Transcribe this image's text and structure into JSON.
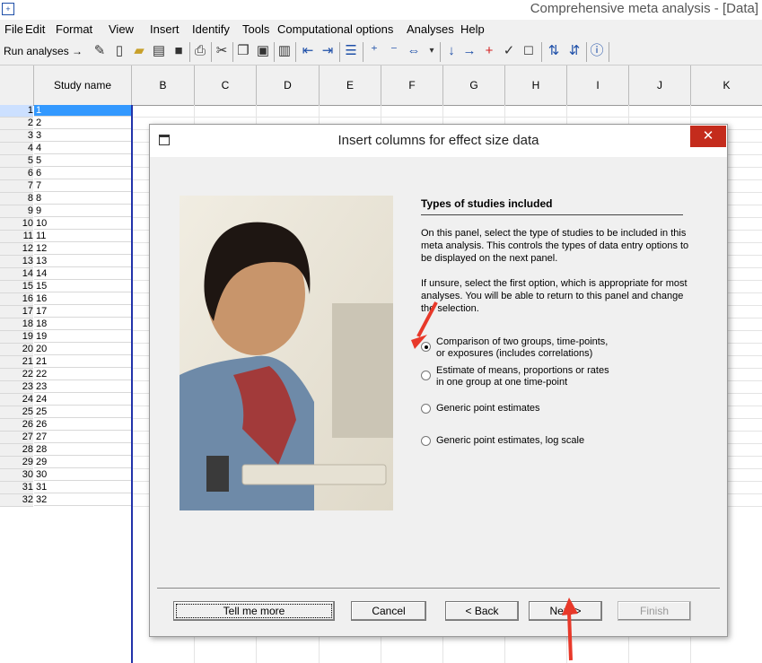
{
  "window": {
    "title": "Comprehensive meta analysis - [Data]",
    "app_icon": "app-icon"
  },
  "menu": [
    "File",
    "Edit",
    "Format",
    "View",
    "Insert",
    "Identify",
    "Tools",
    "Computational options",
    "Analyses",
    "Help"
  ],
  "toolbar": {
    "run_label": "Run analyses →"
  },
  "grid": {
    "columns": [
      "Study name",
      "B",
      "C",
      "D",
      "E",
      "F",
      "G",
      "H",
      "I",
      "J",
      "K"
    ],
    "rows": [
      "1",
      "2",
      "3",
      "4",
      "5",
      "6",
      "7",
      "8",
      "9",
      "10",
      "11",
      "12",
      "13",
      "14",
      "15",
      "16",
      "17",
      "18",
      "19",
      "20",
      "21",
      "22",
      "23",
      "24",
      "25",
      "26",
      "27",
      "28",
      "29",
      "30",
      "31",
      "32"
    ]
  },
  "dialog": {
    "title": "Insert columns for effect size data",
    "close_label": "✕",
    "panel_title": "Types of studies included",
    "para1": "On this panel, select the type of studies to be included in this meta analysis.  This controls the types of data entry options to be displayed on the next panel.",
    "para2": "If unsure, select the first option, which is appropriate for most analyses.  You will be able to return to this panel and change the selection.",
    "options": [
      {
        "line1": "Comparison of two groups, time-points,",
        "line2": "or exposures (includes correlations)",
        "selected": true
      },
      {
        "line1": "Estimate of means, proportions or rates",
        "line2": "in one group at one time-point",
        "selected": false
      },
      {
        "line1": "Generic point estimates",
        "line2": "",
        "selected": false
      },
      {
        "line1": "Generic point estimates, log scale",
        "line2": "",
        "selected": false
      }
    ],
    "buttons": {
      "tell_me_more": "Tell me more",
      "cancel": "Cancel",
      "back": "< Back",
      "next": "Next >",
      "finish": "Finish"
    }
  },
  "colors": {
    "accent_red": "#e8392a",
    "selected_row": "#3399ff",
    "close_red": "#c42b1c"
  }
}
